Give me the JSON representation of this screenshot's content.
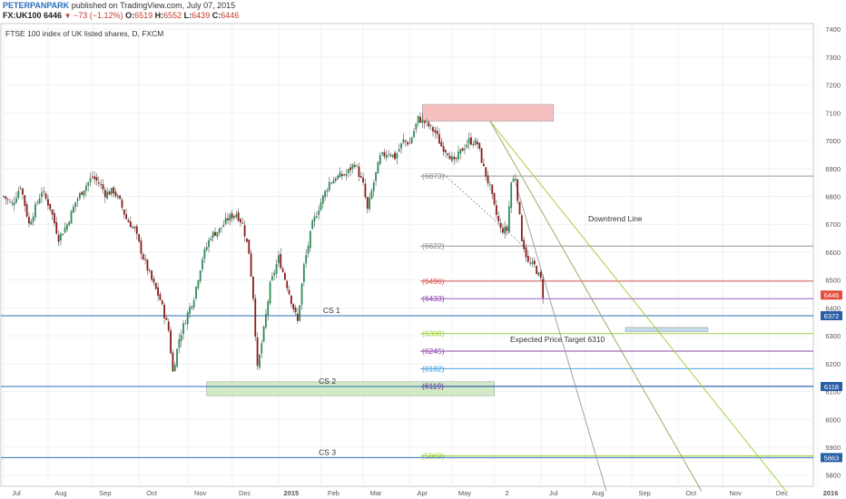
{
  "header": {
    "publisher": "PETERPANPARK",
    "published_text": "published on TradingView.com, July 07, 2015",
    "symbol": "FX:UK100",
    "last": "6446",
    "change": "−73 (−1.12%)",
    "o_label": "O:",
    "o_val": "6519",
    "h_label": "H:",
    "h_val": "6552",
    "l_label": "L:",
    "l_val": "6439",
    "c_label": "C:",
    "c_val": "6446"
  },
  "chart_data": {
    "type": "candlestick",
    "title": "FTSE 100 index of UK listed shares, D, FXCM",
    "y_range": [
      5760,
      7420
    ],
    "y_ticks": [
      5800,
      5900,
      6000,
      6100,
      6200,
      6300,
      6400,
      6500,
      6600,
      6700,
      6800,
      6900,
      7000,
      7100,
      7200,
      7300,
      7400
    ],
    "x_ticks": [
      {
        "label": "Jul",
        "x": 0
      },
      {
        "label": "Aug",
        "x": 21
      },
      {
        "label": "Sep",
        "x": 42
      },
      {
        "label": "Oct",
        "x": 64
      },
      {
        "label": "Nov",
        "x": 87
      },
      {
        "label": "Dec",
        "x": 108
      },
      {
        "label": "2015",
        "x": 130
      },
      {
        "label": "Feb",
        "x": 150
      },
      {
        "label": "Mar",
        "x": 170
      },
      {
        "label": "Apr",
        "x": 192
      },
      {
        "label": "May",
        "x": 212
      },
      {
        "label": "2",
        "x": 232
      },
      {
        "label": "Jul",
        "x": 254
      },
      {
        "label": "Aug",
        "x": 275
      },
      {
        "label": "Sep",
        "x": 297
      },
      {
        "label": "Oct",
        "x": 319
      },
      {
        "label": "Nov",
        "x": 340
      },
      {
        "label": "Dec",
        "x": 362
      },
      {
        "label": "2016",
        "x": 385
      }
    ],
    "close_path": [
      [
        0,
        6800
      ],
      [
        4,
        6770
      ],
      [
        8,
        6840
      ],
      [
        12,
        6700
      ],
      [
        16,
        6780
      ],
      [
        18,
        6820
      ],
      [
        22,
        6760
      ],
      [
        26,
        6650
      ],
      [
        30,
        6700
      ],
      [
        34,
        6780
      ],
      [
        38,
        6830
      ],
      [
        42,
        6870
      ],
      [
        46,
        6840
      ],
      [
        48,
        6810
      ],
      [
        52,
        6820
      ],
      [
        55,
        6780
      ],
      [
        58,
        6720
      ],
      [
        62,
        6680
      ],
      [
        66,
        6580
      ],
      [
        70,
        6500
      ],
      [
        74,
        6430
      ],
      [
        78,
        6320
      ],
      [
        80,
        6170
      ],
      [
        83,
        6290
      ],
      [
        87,
        6380
      ],
      [
        90,
        6440
      ],
      [
        94,
        6580
      ],
      [
        98,
        6660
      ],
      [
        102,
        6680
      ],
      [
        106,
        6720
      ],
      [
        110,
        6740
      ],
      [
        113,
        6700
      ],
      [
        116,
        6600
      ],
      [
        118,
        6440
      ],
      [
        120,
        6180
      ],
      [
        123,
        6320
      ],
      [
        126,
        6480
      ],
      [
        130,
        6580
      ],
      [
        134,
        6480
      ],
      [
        137,
        6400
      ],
      [
        139,
        6350
      ],
      [
        142,
        6550
      ],
      [
        146,
        6700
      ],
      [
        150,
        6780
      ],
      [
        154,
        6850
      ],
      [
        158,
        6870
      ],
      [
        162,
        6880
      ],
      [
        166,
        6920
      ],
      [
        170,
        6840
      ],
      [
        172,
        6750
      ],
      [
        175,
        6850
      ],
      [
        178,
        6940
      ],
      [
        182,
        6960
      ],
      [
        185,
        6940
      ],
      [
        189,
        7000
      ],
      [
        192,
        6990
      ],
      [
        196,
        7080
      ],
      [
        200,
        7060
      ],
      [
        204,
        7030
      ],
      [
        207,
        6980
      ],
      [
        210,
        6960
      ],
      [
        213,
        6920
      ],
      [
        216,
        6960
      ],
      [
        220,
        7000
      ],
      [
        224,
        6990
      ],
      [
        227,
        6900
      ],
      [
        230,
        6830
      ],
      [
        232,
        6760
      ],
      [
        235,
        6680
      ],
      [
        238,
        6680
      ],
      [
        240,
        6850
      ],
      [
        242,
        6870
      ],
      [
        245,
        6650
      ],
      [
        248,
        6560
      ],
      [
        251,
        6550
      ],
      [
        254,
        6500
      ],
      [
        255,
        6446
      ]
    ],
    "levels": [
      {
        "value": 6873,
        "label": "(6873)",
        "color": "#888888"
      },
      {
        "value": 6622,
        "label": "(6622)",
        "color": "#888888"
      },
      {
        "value": 6496,
        "label": "(6496)",
        "color": "#d9534f"
      },
      {
        "value": 6433,
        "label": "(6433)",
        "color": "#8e44ad"
      },
      {
        "value": 6308,
        "label": "(6308)",
        "color": "#9acd32"
      },
      {
        "value": 6245,
        "label": "(6245)",
        "color": "#8e44ad"
      },
      {
        "value": 6182,
        "label": "(6182)",
        "color": "#3498db"
      },
      {
        "value": 6119,
        "label": "(6119)",
        "color": "#6a1b9a"
      },
      {
        "value": 5869,
        "label": "(5869)",
        "color": "#9acd32"
      }
    ],
    "support_lines": [
      {
        "value": 6372,
        "label": "CS 1",
        "badge": "6372",
        "color": "#2a6fba"
      },
      {
        "value": 6118,
        "label": "CS 2",
        "badge": "6118",
        "color": "#2a6fba"
      },
      {
        "value": 5863,
        "label": "CS 3",
        "badge": "5863",
        "color": "#2a6fba"
      }
    ],
    "price_badge": {
      "value": 6446,
      "label": "6446",
      "color": "#e74c3c"
    },
    "annotations": {
      "downtrend_label": "Downtrend Line",
      "target_label": "Expected Price Target 6310"
    },
    "zones": [
      {
        "name": "resistance",
        "x0": 198,
        "x1": 260,
        "y0": 7070,
        "y1": 7130,
        "color": "#f4b9b9"
      },
      {
        "name": "support",
        "x0": 96,
        "x1": 232,
        "y0": 6085,
        "y1": 6135,
        "color": "#cfe8c0"
      },
      {
        "name": "target",
        "x0": 294,
        "x1": 333,
        "y0": 6315,
        "y1": 6330,
        "color": "#bcd8e6"
      }
    ]
  }
}
